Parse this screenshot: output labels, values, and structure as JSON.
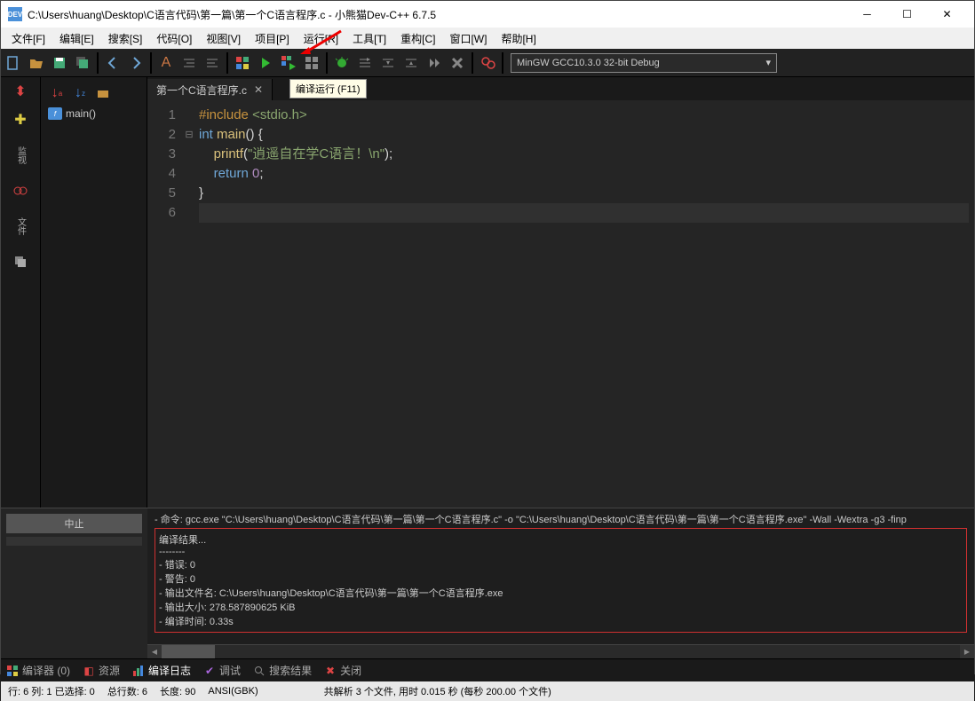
{
  "window": {
    "title": "C:\\Users\\huang\\Desktop\\C语言代码\\第一篇\\第一个C语言程序.c - 小熊猫Dev-C++ 6.7.5",
    "app_icon_text": "DEV"
  },
  "menu": {
    "items": [
      "文件[F]",
      "编辑[E]",
      "搜索[S]",
      "代码[O]",
      "视图[V]",
      "项目[P]",
      "运行[R]",
      "工具[T]",
      "重构[C]",
      "窗口[W]",
      "帮助[H]"
    ]
  },
  "toolbar": {
    "compiler": "MinGW GCC10.3.0 32-bit Debug",
    "tooltip": "编译运行 (F11)"
  },
  "tree": {
    "main_label": "main()"
  },
  "tab": {
    "label": "第一个C语言程序.c"
  },
  "code": {
    "lines": [
      {
        "n": "1",
        "html": "<span class='inc'>#include</span> <span class='str'>&lt;stdio.h&gt;</span>"
      },
      {
        "n": "2",
        "html": "<span class='kw'>int</span> <span class='fn'>main</span>() {"
      },
      {
        "n": "3",
        "html": "    <span class='fn'>printf</span>(<span class='str'>\"逍遥自在学C语言！\\n\"</span>);"
      },
      {
        "n": "4",
        "html": "    <span class='kw'>return</span> <span class='num'>0</span>;"
      },
      {
        "n": "5",
        "html": "}"
      },
      {
        "n": "6",
        "html": ""
      }
    ]
  },
  "compile": {
    "stop_btn": "中止",
    "cmd": "- 命令: gcc.exe \"C:\\Users\\huang\\Desktop\\C语言代码\\第一篇\\第一个C语言程序.c\" -o \"C:\\Users\\huang\\Desktop\\C语言代码\\第一篇\\第一个C语言程序.exe\" -Wall -Wextra -g3 -finp",
    "result_header": "编译结果...",
    "dashes": "--------",
    "errors": "- 错误: 0",
    "warnings": "- 警告: 0",
    "output_file": "- 输出文件名: C:\\Users\\huang\\Desktop\\C语言代码\\第一篇\\第一个C语言程序.exe",
    "output_size": "- 输出大小: 278.587890625 KiB",
    "compile_time": "- 编译时间: 0.33s"
  },
  "bottom_tabs": {
    "compiler": "编译器 (0)",
    "resource": "资源",
    "log": "编译日志",
    "debug": "调试",
    "search": "搜索结果",
    "close": "关闭"
  },
  "status": {
    "line_col": "行:    6    列:    1    已选择:    0",
    "total_lines": "总行数:    6",
    "length": "长度:    90",
    "encoding": "ANSI(GBK)",
    "parse": "共解析 3 个文件, 用时 0.015 秒 (每秒 200.00 个文件)"
  }
}
